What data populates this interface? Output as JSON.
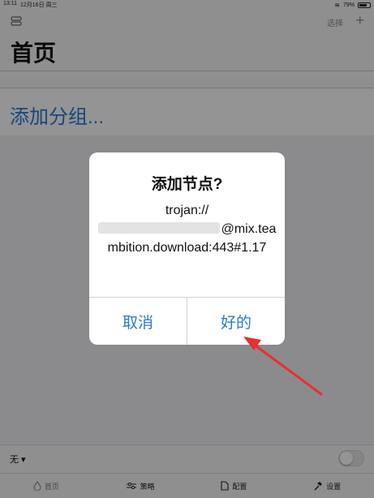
{
  "status_bar": {
    "time": "13:11",
    "date": "12月16日 周三",
    "battery_text": "79%",
    "battery_level": 0.79
  },
  "header": {
    "select_label": "选择",
    "add_label": "+"
  },
  "page_title": "首页",
  "add_group_label": "添加分组...",
  "bottom_bar": {
    "route_value": "无 ▾"
  },
  "tabs": [
    {
      "label": "首页",
      "icon": "drop-icon"
    },
    {
      "label": "策略",
      "icon": "sliders-icon"
    },
    {
      "label": "配置",
      "icon": "document-icon"
    },
    {
      "label": "设置",
      "icon": "hammer-icon"
    }
  ],
  "dialog": {
    "title": "添加节点?",
    "message_line1": "trojan://",
    "message_rest": "@mix.teambition.download:443#1.17",
    "cancel_label": "取消",
    "ok_label": "好的"
  },
  "colors": {
    "accent": "#2a79d2",
    "annotation_arrow": "#e8302f"
  }
}
